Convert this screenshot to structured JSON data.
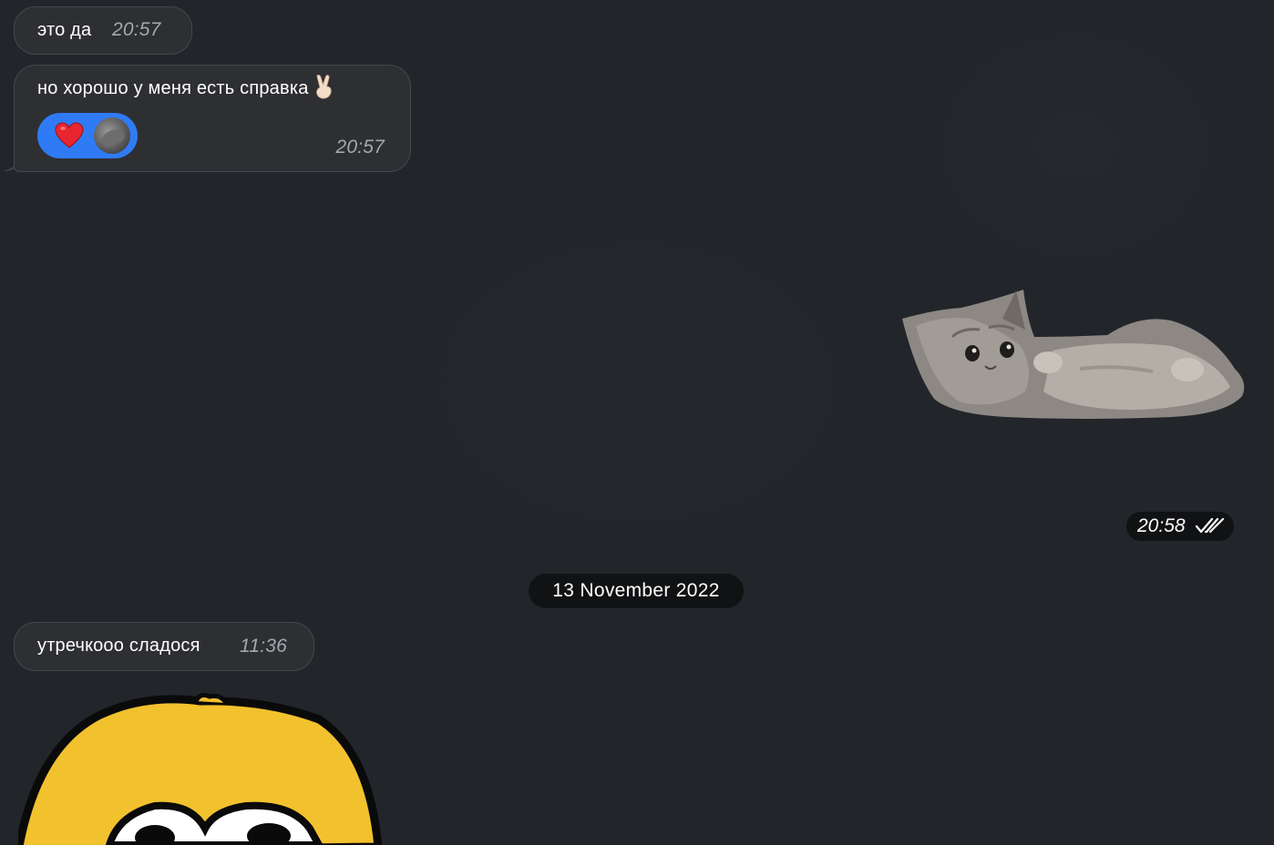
{
  "messages": [
    {
      "text": "это да",
      "time": "20:57"
    },
    {
      "text": "но хорошо у меня есть справка",
      "emoji": "victory-hand-icon",
      "time": "20:57",
      "reaction": {
        "emoji": "heart-icon",
        "color": "#2f7bf5"
      }
    },
    {
      "sticker": "cat-sticker",
      "time": "20:58",
      "status": "double-check-icon"
    },
    {
      "text": "утречкooo сладося",
      "time": "11:36"
    },
    {
      "sticker": "yellow-face-sticker"
    }
  ],
  "date_separator": "13 November 2022",
  "colors": {
    "background": "#22252a",
    "bubble": "#2e2f33",
    "bubble_border": "#45474c",
    "time": "#a4a7ad",
    "pill": "#111214",
    "reaction": "#2f7bf5",
    "heart": "#e8262f",
    "face": "#f2c12e"
  }
}
